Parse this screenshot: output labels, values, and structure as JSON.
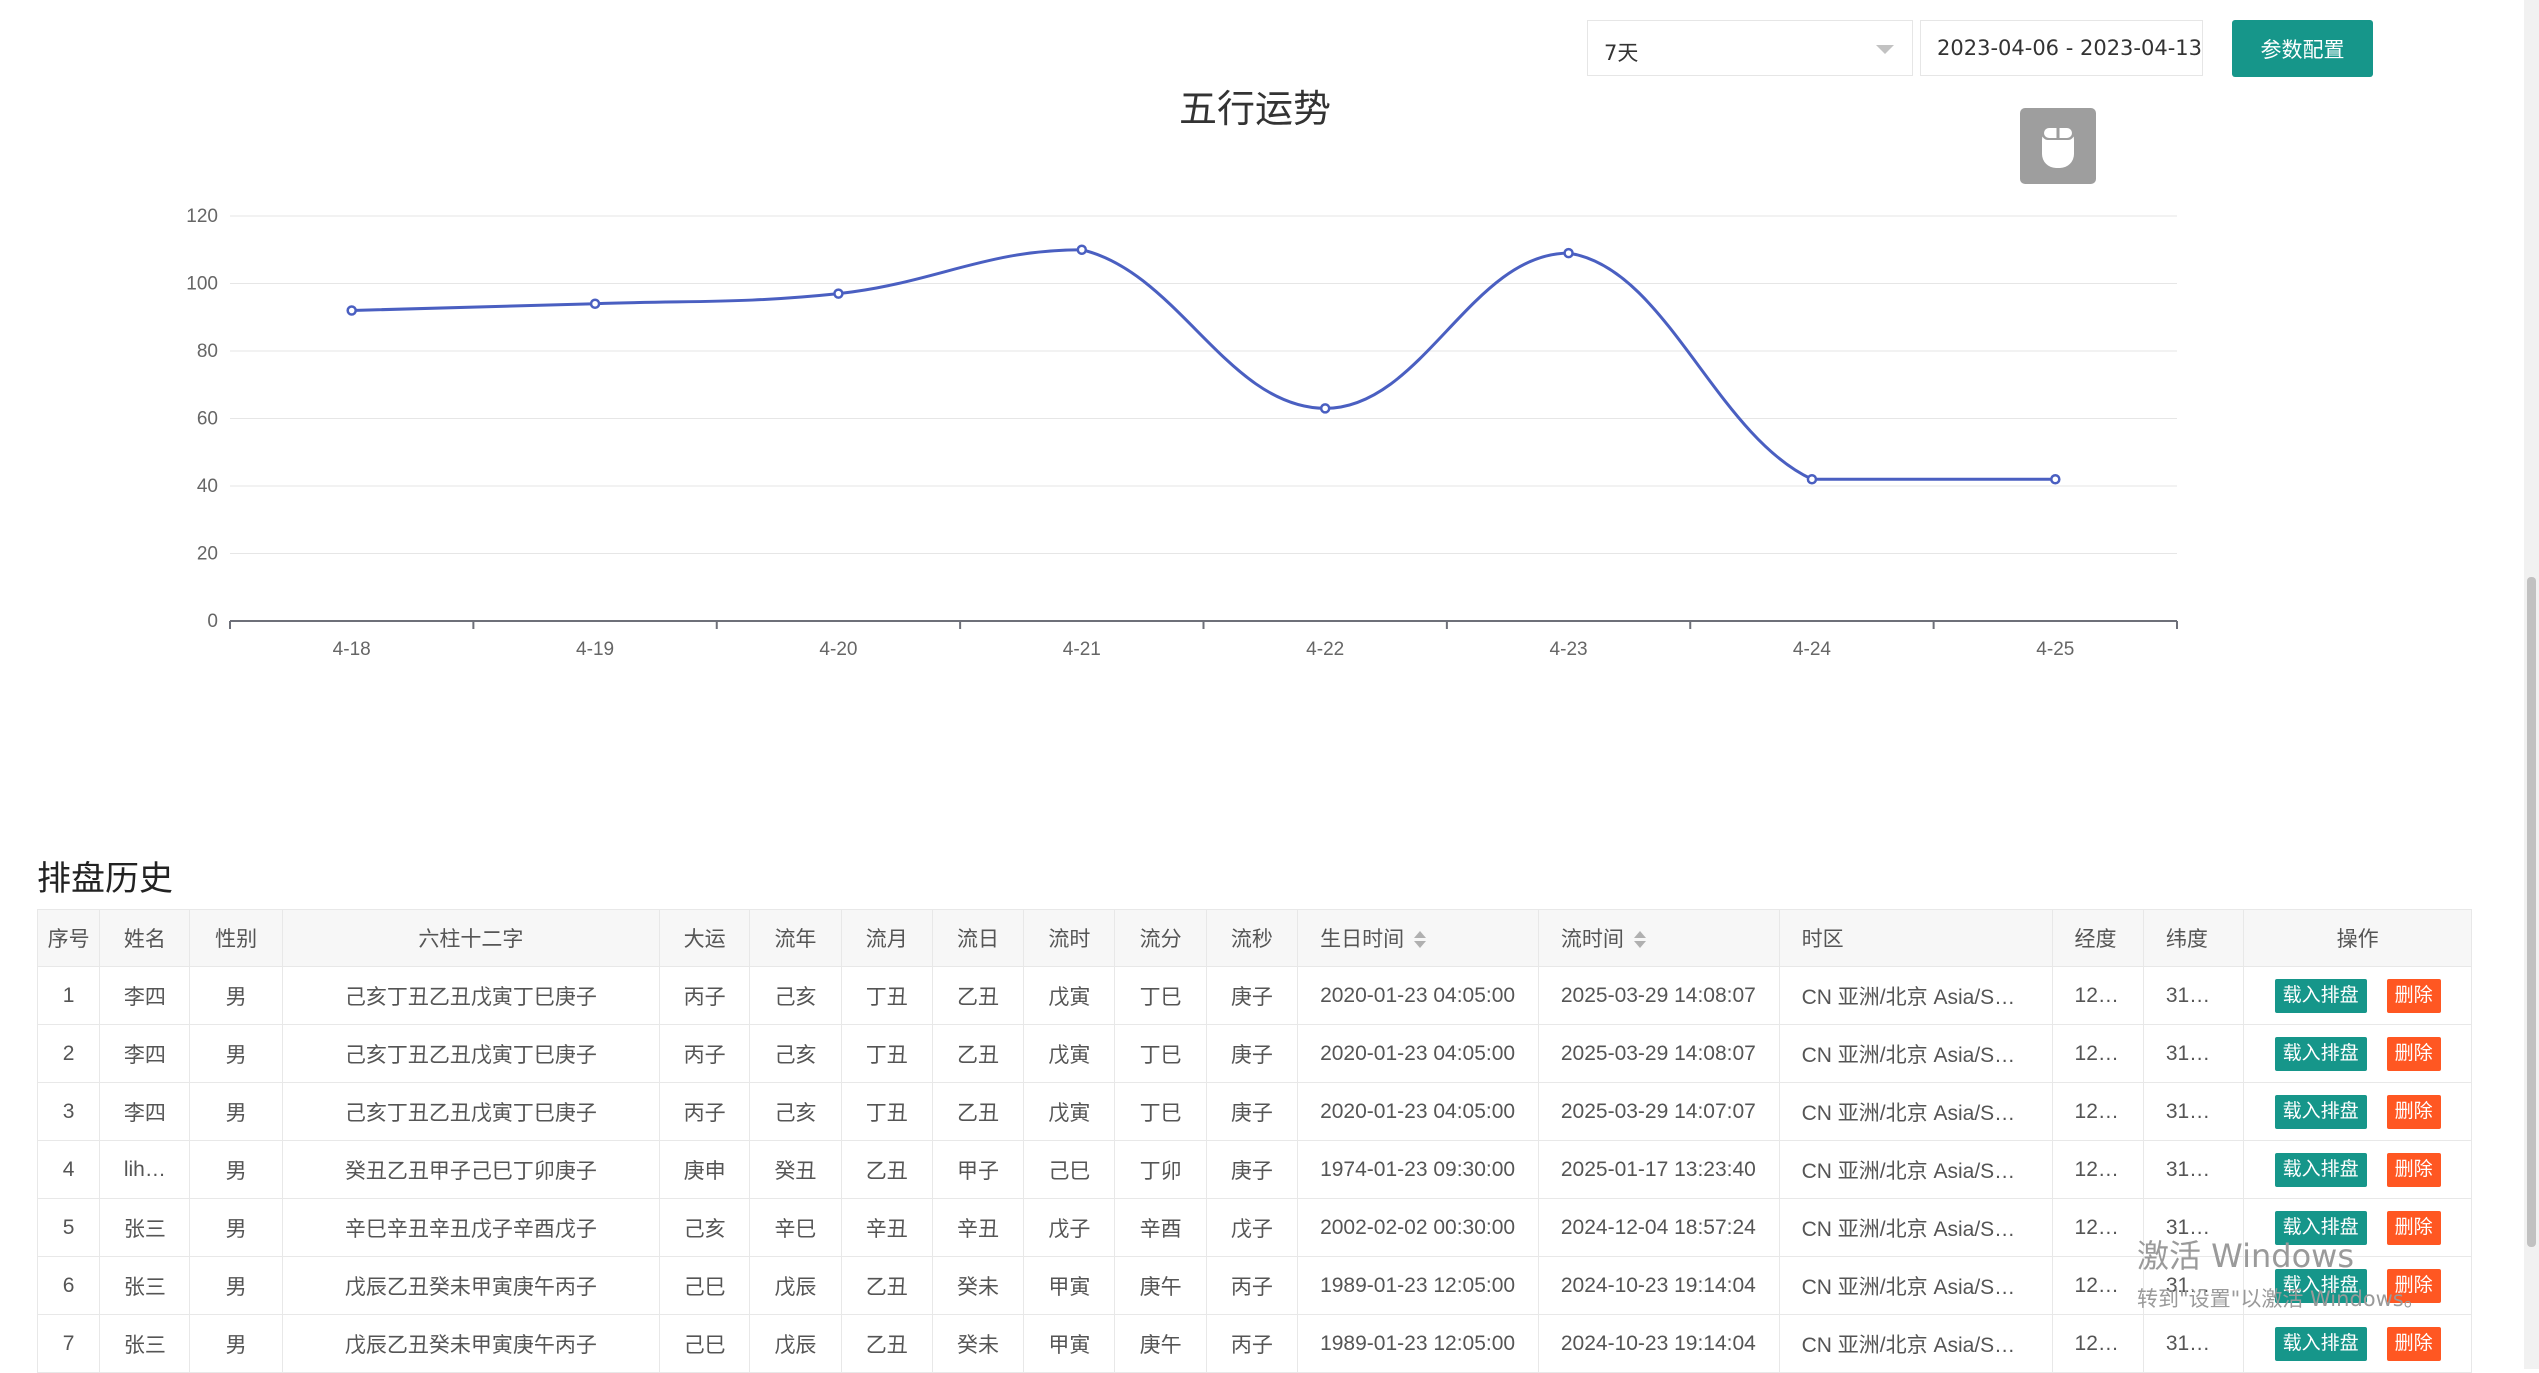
{
  "toolbar": {
    "range_value": "7天",
    "date_range": "2023-04-06 - 2023-04-13",
    "config_label": "参数配置"
  },
  "chart_data": {
    "type": "line",
    "title": "五行运势",
    "categories": [
      "4-18",
      "4-19",
      "4-20",
      "4-21",
      "4-22",
      "4-23",
      "4-24",
      "4-25"
    ],
    "series": [
      {
        "values": [
          92,
          94,
          97,
          110,
          63,
          109,
          42,
          42
        ],
        "color": "#4a5fc1"
      }
    ],
    "ylim": [
      0,
      120
    ],
    "yticks": [
      0,
      20,
      40,
      60,
      80,
      100,
      120
    ],
    "grid": true,
    "smooth": true
  },
  "history": {
    "title": "排盘历史",
    "columns": [
      "序号",
      "姓名",
      "性别",
      "六柱十二字",
      "大运",
      "流年",
      "流月",
      "流日",
      "流时",
      "流分",
      "流秒",
      "生日时间",
      "流时间",
      "时区",
      "经度",
      "纬度",
      "操作"
    ],
    "load_label": "载入排盘",
    "delete_label": "删除",
    "rows": [
      {
        "id": "1",
        "name": "李四",
        "gender": "男",
        "bazi": "己亥丁丑乙丑戊寅丁巳庚子",
        "dayun": "丙子",
        "liunian": "己亥",
        "liuyue": "丁丑",
        "liuri": "乙丑",
        "liushi": "戊寅",
        "liufen": "丁巳",
        "liumiao": "庚子",
        "birth": "2020-01-23 04:05:00",
        "flow": "2025-03-29 14:08:07",
        "tz": "CN 亚洲/北京 Asia/S…",
        "lng": "12…",
        "lat": "31…"
      },
      {
        "id": "2",
        "name": "李四",
        "gender": "男",
        "bazi": "己亥丁丑乙丑戊寅丁巳庚子",
        "dayun": "丙子",
        "liunian": "己亥",
        "liuyue": "丁丑",
        "liuri": "乙丑",
        "liushi": "戊寅",
        "liufen": "丁巳",
        "liumiao": "庚子",
        "birth": "2020-01-23 04:05:00",
        "flow": "2025-03-29 14:08:07",
        "tz": "CN 亚洲/北京 Asia/S…",
        "lng": "12…",
        "lat": "31…"
      },
      {
        "id": "3",
        "name": "李四",
        "gender": "男",
        "bazi": "己亥丁丑乙丑戊寅丁巳庚子",
        "dayun": "丙子",
        "liunian": "己亥",
        "liuyue": "丁丑",
        "liuri": "乙丑",
        "liushi": "戊寅",
        "liufen": "丁巳",
        "liumiao": "庚子",
        "birth": "2020-01-23 04:05:00",
        "flow": "2025-03-29 14:07:07",
        "tz": "CN 亚洲/北京 Asia/S…",
        "lng": "12…",
        "lat": "31…"
      },
      {
        "id": "4",
        "name": "lih…",
        "gender": "男",
        "bazi": "癸丑乙丑甲子己巳丁卯庚子",
        "dayun": "庚申",
        "liunian": "癸丑",
        "liuyue": "乙丑",
        "liuri": "甲子",
        "liushi": "己巳",
        "liufen": "丁卯",
        "liumiao": "庚子",
        "birth": "1974-01-23 09:30:00",
        "flow": "2025-01-17 13:23:40",
        "tz": "CN 亚洲/北京 Asia/S…",
        "lng": "12…",
        "lat": "31…"
      },
      {
        "id": "5",
        "name": "张三",
        "gender": "男",
        "bazi": "辛巳辛丑辛丑戊子辛酉戊子",
        "dayun": "己亥",
        "liunian": "辛巳",
        "liuyue": "辛丑",
        "liuri": "辛丑",
        "liushi": "戊子",
        "liufen": "辛酉",
        "liumiao": "戊子",
        "birth": "2002-02-02 00:30:00",
        "flow": "2024-12-04 18:57:24",
        "tz": "CN 亚洲/北京 Asia/S…",
        "lng": "12…",
        "lat": "31…"
      },
      {
        "id": "6",
        "name": "张三",
        "gender": "男",
        "bazi": "戊辰乙丑癸未甲寅庚午丙子",
        "dayun": "己巳",
        "liunian": "戊辰",
        "liuyue": "乙丑",
        "liuri": "癸未",
        "liushi": "甲寅",
        "liufen": "庚午",
        "liumiao": "丙子",
        "birth": "1989-01-23 12:05:00",
        "flow": "2024-10-23 19:14:04",
        "tz": "CN 亚洲/北京 Asia/S…",
        "lng": "12…",
        "lat": "31…"
      },
      {
        "id": "7",
        "name": "张三",
        "gender": "男",
        "bazi": "戊辰乙丑癸未甲寅庚午丙子",
        "dayun": "己巳",
        "liunian": "戊辰",
        "liuyue": "乙丑",
        "liuri": "癸未",
        "liushi": "甲寅",
        "liufen": "庚午",
        "liumiao": "丙子",
        "birth": "1989-01-23 12:05:00",
        "flow": "2024-10-23 19:14:04",
        "tz": "CN 亚洲/北京 Asia/S…",
        "lng": "12…",
        "lat": "31…"
      }
    ]
  },
  "watermark": {
    "line1": "激活 Windows",
    "line2": "转到\"设置\"以激活 Windows。"
  }
}
